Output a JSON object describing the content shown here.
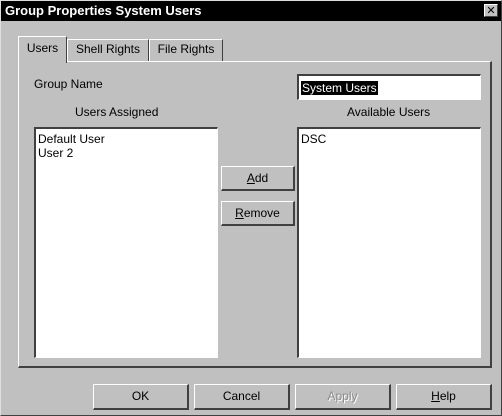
{
  "window": {
    "title": "Group Properties System Users",
    "close_glyph": "✕"
  },
  "tabs": [
    {
      "label": "Users",
      "active": true
    },
    {
      "label": "Shell Rights",
      "active": false
    },
    {
      "label": "File Rights",
      "active": false
    }
  ],
  "form": {
    "group_name_label": "Group Name",
    "group_name_value": "System Users",
    "users_assigned_label": "Users Assigned",
    "available_users_label": "Available Users",
    "users_assigned": [
      "Default User",
      "User 2"
    ],
    "available_users": [
      "DSC"
    ]
  },
  "middle_buttons": {
    "add": {
      "mnemonic": "A",
      "rest": "dd"
    },
    "remove": {
      "mnemonic": "R",
      "rest": "emove"
    }
  },
  "footer_buttons": {
    "ok": "OK",
    "cancel": "Cancel",
    "apply": "Apply",
    "help": {
      "mnemonic": "H",
      "rest": "elp"
    }
  }
}
